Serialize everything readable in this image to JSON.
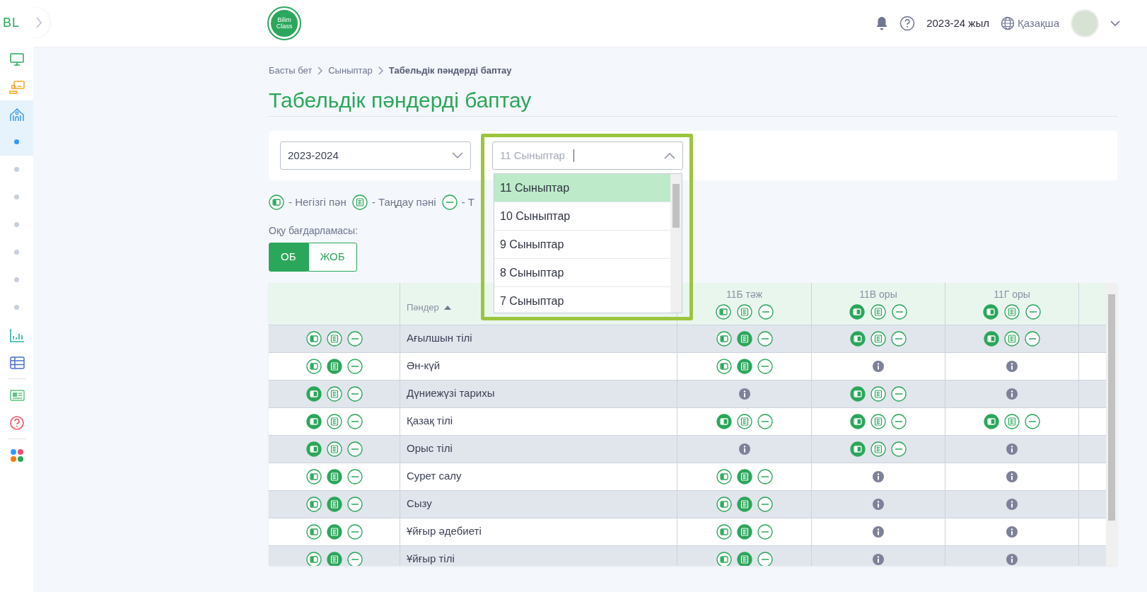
{
  "sidebar": {
    "logo": "BL",
    "items": [
      {
        "kind": "icon",
        "selected": false
      },
      {
        "kind": "icon",
        "selected": false
      },
      {
        "kind": "icon",
        "selected": true
      },
      {
        "kind": "dot",
        "selected": true
      },
      {
        "kind": "dot",
        "selected": false
      },
      {
        "kind": "dot",
        "selected": false
      },
      {
        "kind": "dot",
        "selected": false
      },
      {
        "kind": "dot",
        "selected": false
      },
      {
        "kind": "dot",
        "selected": false
      },
      {
        "kind": "dot",
        "selected": false
      },
      {
        "kind": "icon",
        "selected": false
      },
      {
        "kind": "icon",
        "selected": false
      },
      {
        "kind": "icon",
        "selected": false
      },
      {
        "kind": "icon",
        "selected": false
      },
      {
        "kind": "icon",
        "selected": false
      }
    ]
  },
  "header": {
    "logo": [
      "Bilim",
      "Class"
    ],
    "year": "2023-24 жыл",
    "language": "Қазақша"
  },
  "breadcrumb": [
    "Басты бет",
    "Сыныптар",
    "Табельдік пәндерді баптау"
  ],
  "title": "Табельдік пәндерді баптау",
  "filters": {
    "year_select": {
      "value": "2023-2024"
    },
    "class_select": {
      "placeholder": "11 Сыныптар",
      "expanded": true,
      "options": [
        {
          "label": "11 Сыныптар",
          "selected": true
        },
        {
          "label": "10 Сыныптар",
          "selected": false
        },
        {
          "label": "9 Сыныптар",
          "selected": false
        },
        {
          "label": "8 Сыныптар",
          "selected": false
        },
        {
          "label": "7 Сыныптар",
          "selected": false
        }
      ]
    }
  },
  "legend": [
    {
      "kind": "main",
      "text": "- Негізгі пән"
    },
    {
      "kind": "elective",
      "text": "- Таңдау пәні"
    },
    {
      "kind": "none",
      "text": "- Т"
    }
  ],
  "program": {
    "label": "Оқу бағдарламасы:",
    "options": [
      {
        "label": "ОБ",
        "selected": true
      },
      {
        "label": "ЖОБ",
        "selected": false
      }
    ]
  },
  "table": {
    "subject_column": {
      "label": "Пәндер",
      "sorted": true
    },
    "class_columns": [
      {
        "label": "11Б тәж",
        "main": false,
        "elective": false
      },
      {
        "label": "11В оры",
        "main": true,
        "elective": false
      },
      {
        "label": "11Г оры",
        "main": true,
        "elective": false
      }
    ],
    "rows": [
      {
        "subject": "Ағылшын тілі",
        "main": false,
        "elective": false,
        "cells": [
          {
            "kind": "choice",
            "main": false,
            "elective": true
          },
          {
            "kind": "choice",
            "main": true,
            "elective": false
          },
          {
            "kind": "choice",
            "main": true,
            "elective": false
          }
        ]
      },
      {
        "subject": "Ән-күй",
        "main": false,
        "elective": true,
        "cells": [
          {
            "kind": "choice",
            "main": false,
            "elective": true
          },
          {
            "kind": "info"
          },
          {
            "kind": "info"
          }
        ]
      },
      {
        "subject": "Дүниежүзі тарихы",
        "main": true,
        "elective": false,
        "cells": [
          {
            "kind": "info"
          },
          {
            "kind": "choice",
            "main": true,
            "elective": false
          },
          {
            "kind": "info"
          }
        ]
      },
      {
        "subject": "Қазақ тілі",
        "main": true,
        "elective": false,
        "cells": [
          {
            "kind": "choice",
            "main": true,
            "elective": false
          },
          {
            "kind": "choice",
            "main": true,
            "elective": false
          },
          {
            "kind": "choice",
            "main": true,
            "elective": false
          }
        ]
      },
      {
        "subject": "Орыс тілі",
        "main": true,
        "elective": false,
        "cells": [
          {
            "kind": "info"
          },
          {
            "kind": "choice",
            "main": true,
            "elective": false
          },
          {
            "kind": "info"
          }
        ]
      },
      {
        "subject": "Сурет салу",
        "main": false,
        "elective": true,
        "cells": [
          {
            "kind": "choice",
            "main": false,
            "elective": true
          },
          {
            "kind": "info"
          },
          {
            "kind": "info"
          }
        ]
      },
      {
        "subject": "Сызу",
        "main": false,
        "elective": true,
        "cells": [
          {
            "kind": "choice",
            "main": false,
            "elective": true
          },
          {
            "kind": "info"
          },
          {
            "kind": "info"
          }
        ]
      },
      {
        "subject": "Ұйғыр әдебиеті",
        "main": false,
        "elective": true,
        "cells": [
          {
            "kind": "choice",
            "main": false,
            "elective": true
          },
          {
            "kind": "info"
          },
          {
            "kind": "info"
          }
        ]
      },
      {
        "subject": "Ұйғыр тілі",
        "main": false,
        "elective": true,
        "cells": [
          {
            "kind": "choice",
            "main": false,
            "elective": true
          },
          {
            "kind": "info"
          },
          {
            "kind": "info"
          }
        ]
      }
    ]
  }
}
